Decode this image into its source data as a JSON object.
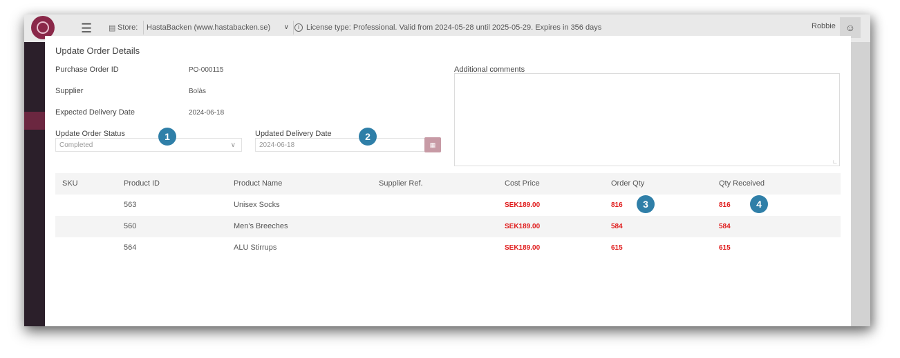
{
  "topbar": {
    "store_label": "Store:",
    "store_value": "HastaBacken (www.hastabacken.se)",
    "license_text": "License type: Professional. Valid from 2024-05-28 until 2025-05-29. Expires in 356 days",
    "user_name": "Robbie"
  },
  "modal": {
    "title": "Update Order Details",
    "purchase_order_id_label": "Purchase Order ID",
    "purchase_order_id": "PO-000115",
    "supplier_label": "Supplier",
    "supplier": "Bolàs",
    "expected_delivery_label": "Expected Delivery Date",
    "expected_delivery": "2024-06-18",
    "status_label": "Update Order Status",
    "status_value": "Completed",
    "updated_delivery_label": "Updated Delivery Date",
    "updated_delivery_value": "2024-06-18",
    "comments_label": "Additional comments"
  },
  "badges": [
    "1",
    "2",
    "3",
    "4"
  ],
  "table": {
    "headers": [
      "SKU",
      "Product ID",
      "Product Name",
      "Supplier Ref.",
      "Cost Price",
      "Order Qty",
      "Qty Received"
    ],
    "rows": [
      {
        "sku": "",
        "product_id": "563",
        "product_name": "Unisex Socks",
        "supplier_ref": "",
        "cost_price": "SEK189.00",
        "order_qty": "816",
        "qty_received": "816"
      },
      {
        "sku": "",
        "product_id": "560",
        "product_name": "Men's Breeches",
        "supplier_ref": "",
        "cost_price": "SEK189.00",
        "order_qty": "584",
        "qty_received": "584"
      },
      {
        "sku": "",
        "product_id": "564",
        "product_name": "ALU Stirrups",
        "supplier_ref": "",
        "cost_price": "SEK189.00",
        "order_qty": "615",
        "qty_received": "615"
      }
    ]
  },
  "colors": {
    "accent": "#8a2849",
    "badge": "#2f7fa8",
    "qty_red": "#e01b1b"
  }
}
